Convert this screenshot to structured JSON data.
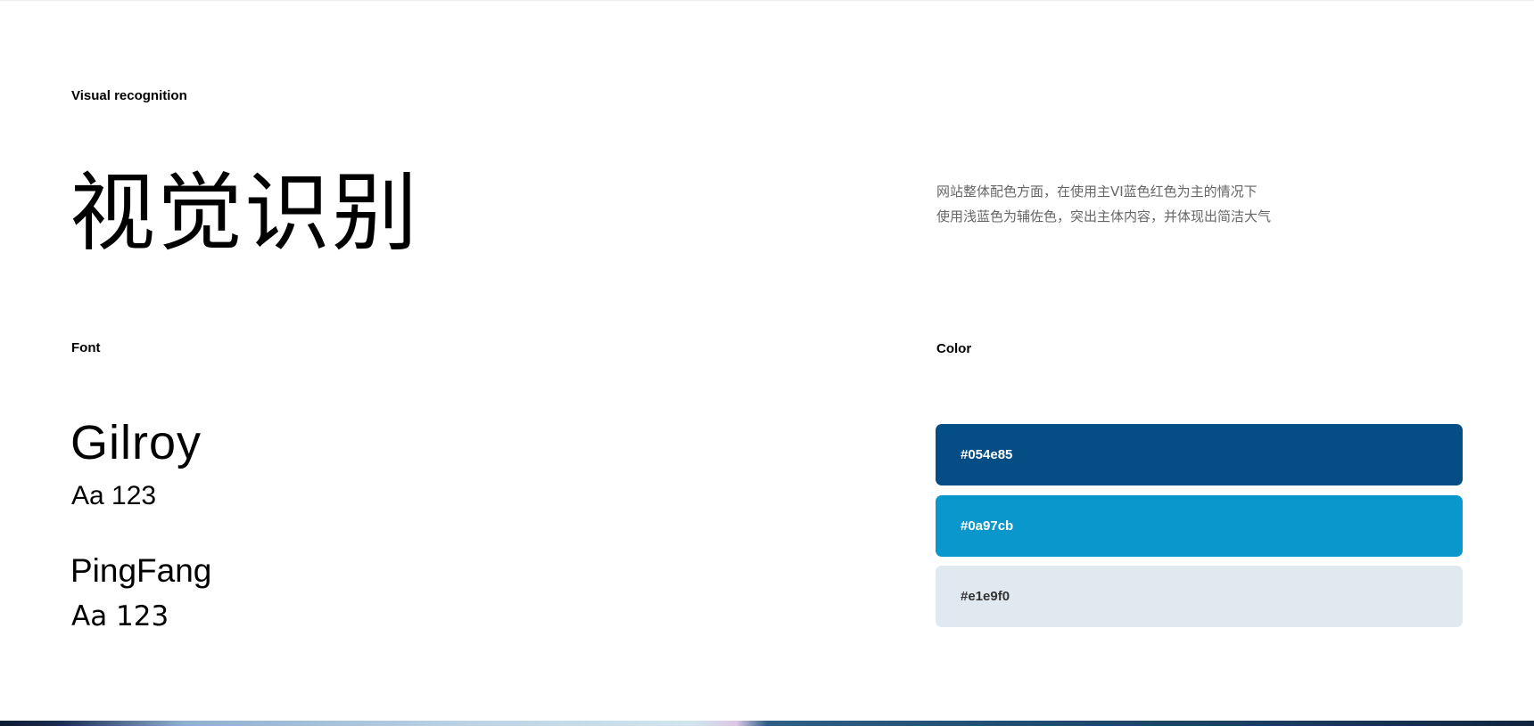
{
  "header": {
    "eyebrow": "Visual recognition",
    "title": "视觉识别"
  },
  "description": {
    "line1": "网站整体配色方面，在使用主VI蓝色红色为主的情况下",
    "line2": "使用浅蓝色为辅佐色，突出主体内容，并体现出简洁大气"
  },
  "fonts": {
    "label": "Font",
    "items": [
      {
        "name": "Gilroy",
        "sample": "Aa 123"
      },
      {
        "name": "PingFang",
        "sample": "Aa 123"
      }
    ]
  },
  "colors": {
    "label": "Color",
    "swatches": [
      {
        "hex": "#054e85",
        "text_color": "#ffffff"
      },
      {
        "hex": "#0a97cb",
        "text_color": "#ffffff"
      },
      {
        "hex": "#e1e9f0",
        "text_color": "#333333"
      }
    ]
  }
}
